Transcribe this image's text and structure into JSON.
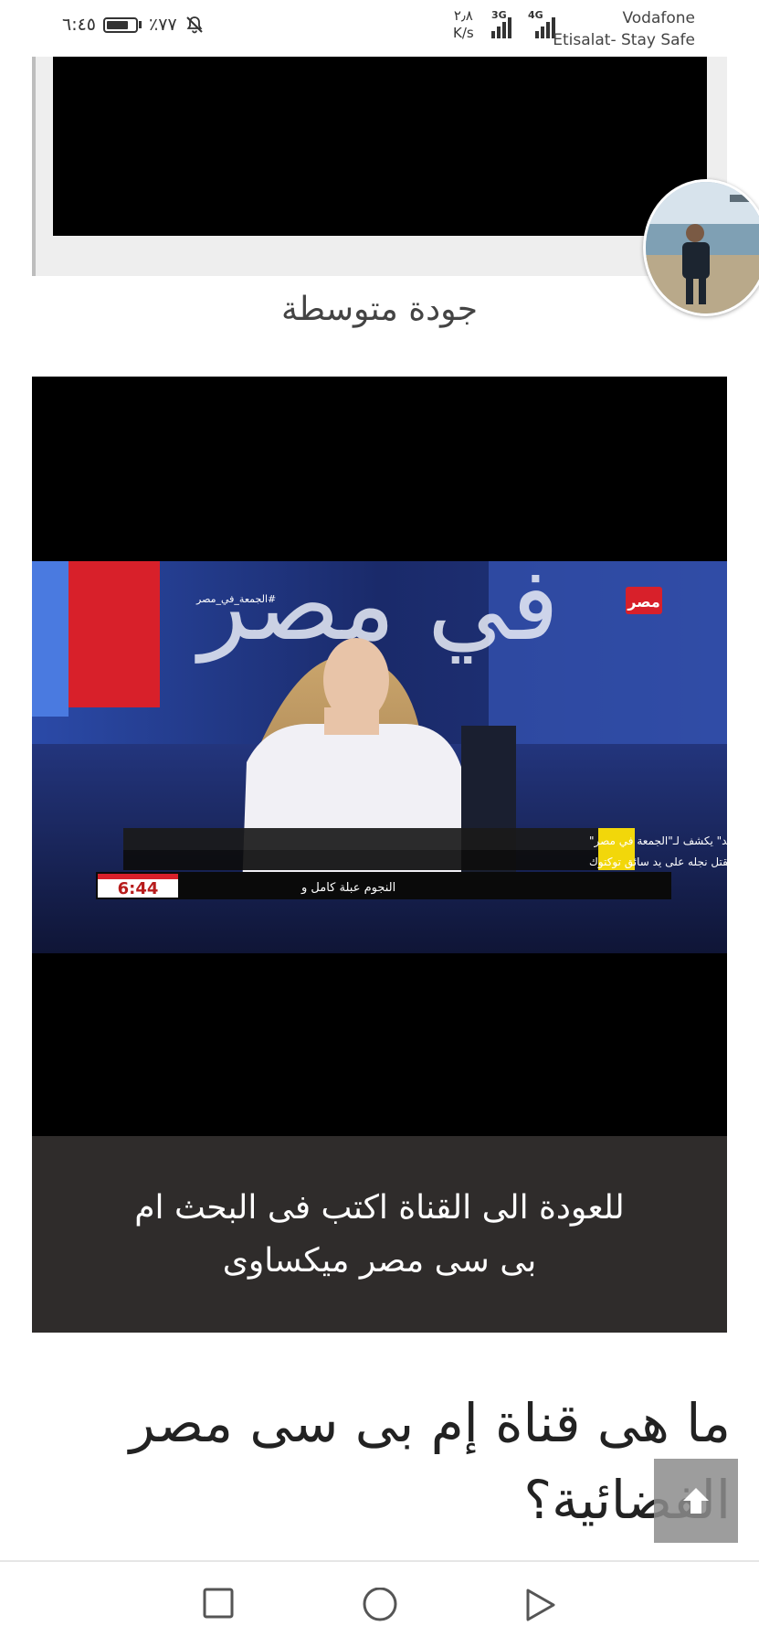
{
  "status_bar": {
    "time": "٦:٤٥",
    "battery": "٪٧٧",
    "battery_level": 0.77,
    "net_speed_value": "٢٫٨",
    "net_speed_unit": "K/s",
    "signal_1_type": "3G",
    "signal_2_type": "4G",
    "carrier_line1": "Vodafone",
    "carrier_line2": "Etisalat- Stay Safe",
    "icons": [
      "silent-bell-icon",
      "battery-icon",
      "signal-icon"
    ]
  },
  "top_card": {
    "caption": "جودة متوسطة"
  },
  "video": {
    "overlay_logo": "مصر",
    "hashtag": "#الجمعة_في_مصر",
    "backdrop_text": "في مصر",
    "ticker_line1": "فشل في اغتصابه فقتله.. والد الطفل \"فهد\" يكشف لـ\"الجمعة في مصر\"",
    "ticker_line2": "تفاصيل مقتل نجله على يد سائق توكتوك",
    "ticker_line3": "النجوم عبلة كامل و",
    "clock": "6:44",
    "subtitle_line1": "للعودة الى القناة اكتب فى البحث ام",
    "subtitle_line2": "بى سى مصر ميكساوى"
  },
  "article": {
    "heading": "ما هى قناة إم بى سى مصر الفضائية؟"
  },
  "nav": {
    "icons": [
      "recents-square-icon",
      "home-circle-icon",
      "back-triangle-icon"
    ]
  },
  "colors": {
    "subtitle_bg": "#2f2c2b",
    "ticker_yellow": "#f2d70a",
    "studio_blue": "#1f3a8f",
    "studio_red": "#d8202a"
  }
}
